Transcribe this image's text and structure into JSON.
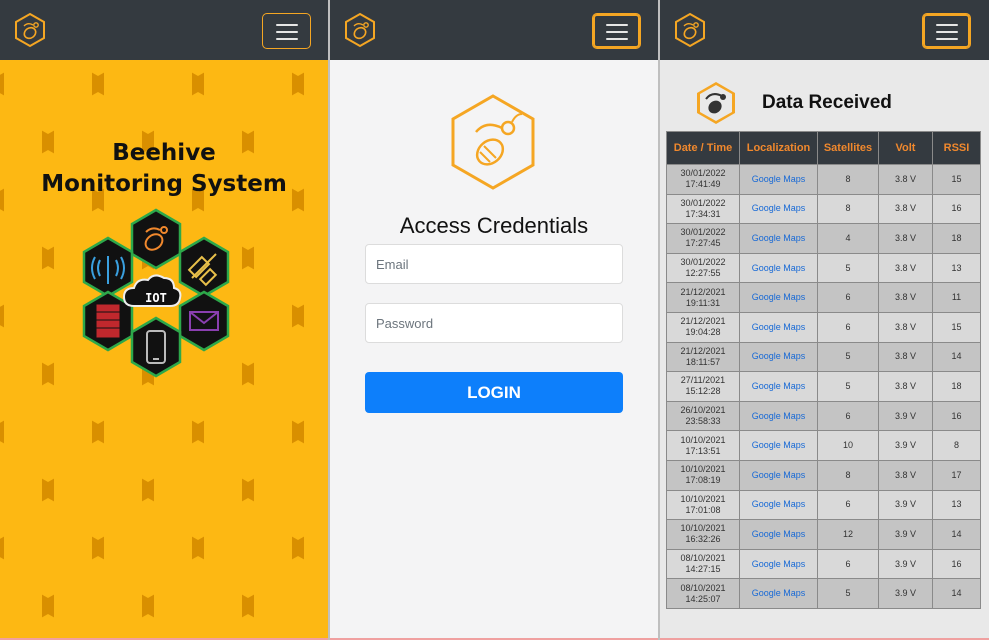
{
  "home": {
    "title_line1": "Beehive",
    "title_line2": "Monitoring System",
    "cluster_center_label": "IOT"
  },
  "login": {
    "title": "Access Credentials",
    "email_placeholder": "Email",
    "password_placeholder": "Password",
    "login_label": "LOGIN"
  },
  "data": {
    "title": "Data Received",
    "columns": [
      "Date / Time",
      "Localization",
      "Satellites",
      "Volt",
      "RSSI"
    ],
    "link_label": "Google Maps",
    "rows": [
      {
        "date": "30/01/2022",
        "time": "17:41:49",
        "sat": "8",
        "volt": "3.8 V",
        "rssi": "15"
      },
      {
        "date": "30/01/2022",
        "time": "17:34:31",
        "sat": "8",
        "volt": "3.8 V",
        "rssi": "16"
      },
      {
        "date": "30/01/2022",
        "time": "17:27:45",
        "sat": "4",
        "volt": "3.8 V",
        "rssi": "18"
      },
      {
        "date": "30/01/2022",
        "time": "12:27:55",
        "sat": "5",
        "volt": "3.8 V",
        "rssi": "13"
      },
      {
        "date": "21/12/2021",
        "time": "19:11:31",
        "sat": "6",
        "volt": "3.8 V",
        "rssi": "11"
      },
      {
        "date": "21/12/2021",
        "time": "19:04:28",
        "sat": "6",
        "volt": "3.8 V",
        "rssi": "15"
      },
      {
        "date": "21/12/2021",
        "time": "18:11:57",
        "sat": "5",
        "volt": "3.8 V",
        "rssi": "14"
      },
      {
        "date": "27/11/2021",
        "time": "15:12:28",
        "sat": "5",
        "volt": "3.8 V",
        "rssi": "18"
      },
      {
        "date": "26/10/2021",
        "time": "23:58:33",
        "sat": "6",
        "volt": "3.9 V",
        "rssi": "16"
      },
      {
        "date": "10/10/2021",
        "time": "17:13:51",
        "sat": "10",
        "volt": "3.9 V",
        "rssi": "8"
      },
      {
        "date": "10/10/2021",
        "time": "17:08:19",
        "sat": "8",
        "volt": "3.8 V",
        "rssi": "17"
      },
      {
        "date": "10/10/2021",
        "time": "17:01:08",
        "sat": "6",
        "volt": "3.9 V",
        "rssi": "13"
      },
      {
        "date": "10/10/2021",
        "time": "16:32:26",
        "sat": "12",
        "volt": "3.9 V",
        "rssi": "14"
      },
      {
        "date": "08/10/2021",
        "time": "14:27:15",
        "sat": "6",
        "volt": "3.9 V",
        "rssi": "16"
      },
      {
        "date": "08/10/2021",
        "time": "14:25:07",
        "sat": "5",
        "volt": "3.9 V",
        "rssi": "14"
      }
    ]
  },
  "colors": {
    "navbar": "#343a40",
    "accent": "#f5a623",
    "honey": "#f6b300",
    "login_button": "#0d7ffb",
    "link": "#1769d6"
  },
  "icons": {
    "nav_logo": "bee-hex-icon",
    "menu": "hamburger-icon",
    "cluster": [
      "bee-icon",
      "antenna-icon",
      "satellite-icon",
      "server-icon",
      "cloud-icon",
      "mail-icon",
      "phone-icon"
    ]
  }
}
